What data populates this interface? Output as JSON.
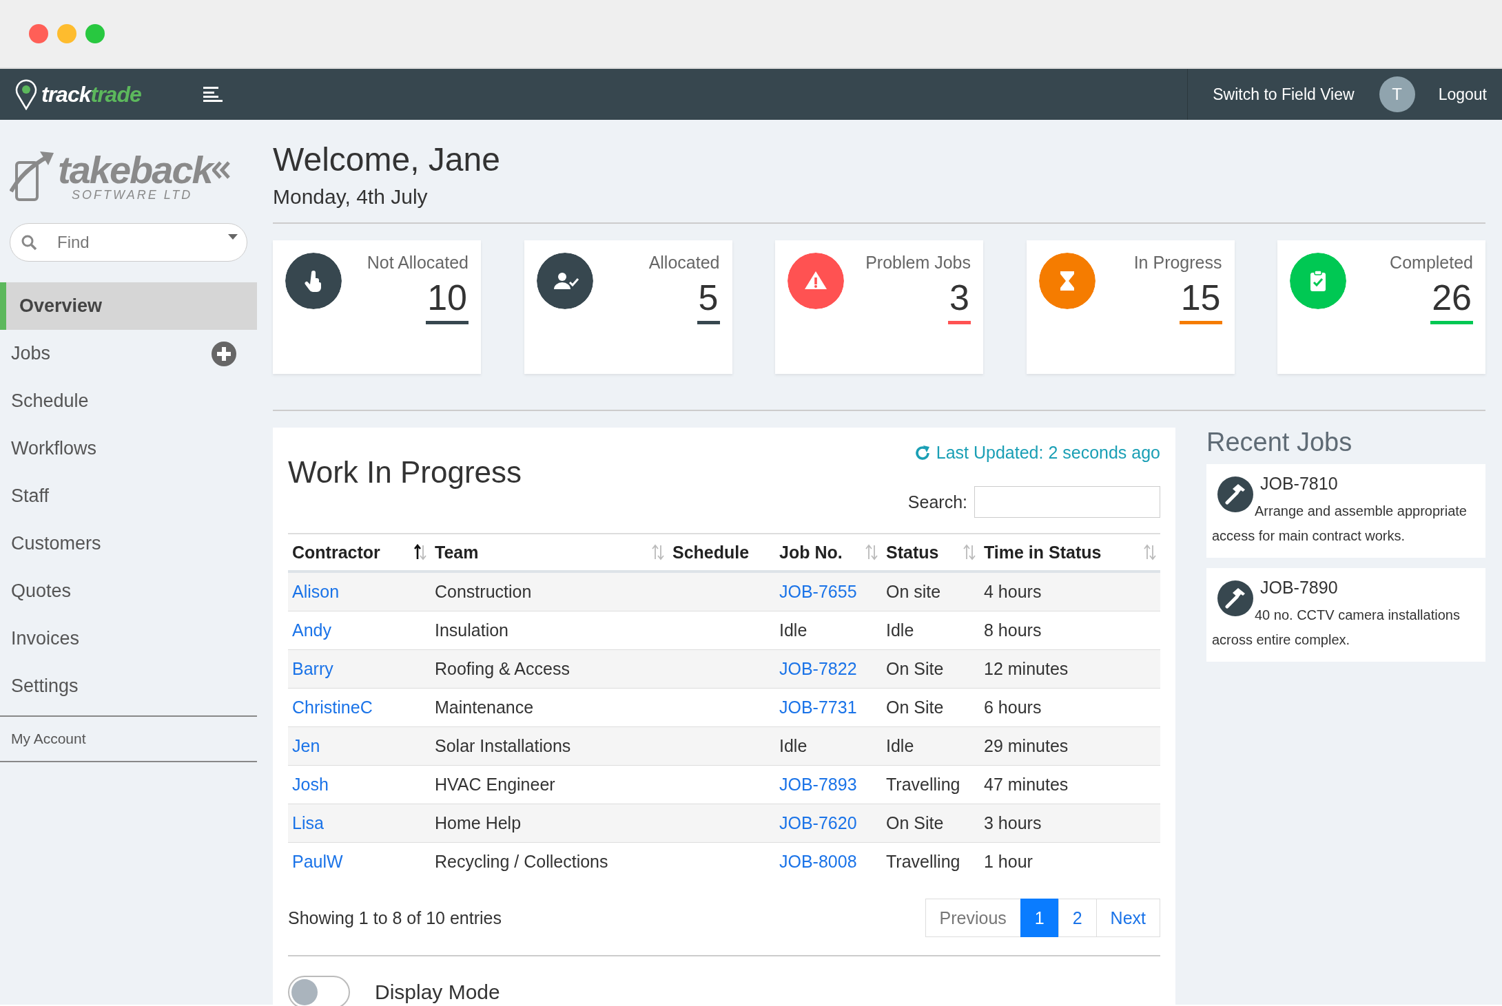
{
  "nav_bar": {
    "brand_part_1": "track",
    "brand_part_2": "trade",
    "switch_link": "Switch to Field View",
    "avatar_initial": "T",
    "logout": "Logout"
  },
  "sidebar": {
    "logo_name": "takeback",
    "logo_sub": "SOFTWARE LTD",
    "find": {
      "placeholder": "Find"
    },
    "items": [
      {
        "label": "Overview",
        "selected": true,
        "add_button": false
      },
      {
        "label": "Jobs",
        "selected": false,
        "add_button": true
      },
      {
        "label": "Schedule",
        "selected": false,
        "add_button": false
      },
      {
        "label": "Workflows",
        "selected": false,
        "add_button": false
      },
      {
        "label": "Staff",
        "selected": false,
        "add_button": false
      },
      {
        "label": "Customers",
        "selected": false,
        "add_button": false
      },
      {
        "label": "Quotes",
        "selected": false,
        "add_button": false
      },
      {
        "label": "Invoices",
        "selected": false,
        "add_button": false
      },
      {
        "label": "Settings",
        "selected": false,
        "add_button": false
      }
    ],
    "account": "My Account"
  },
  "header": {
    "welcome": "Welcome, Jane",
    "date": "Monday, 4th July"
  },
  "stat_cards": [
    {
      "label": "Not Allocated",
      "value": "10",
      "color": "#37474f"
    },
    {
      "label": "Allocated",
      "value": "5",
      "color": "#37474f"
    },
    {
      "label": "Problem Jobs",
      "value": "3",
      "color": "#ff5252"
    },
    {
      "label": "In Progress",
      "value": "15",
      "color": "#f57c00"
    },
    {
      "label": "Completed",
      "value": "26",
      "color": "#00c853"
    }
  ],
  "work_in_progress": {
    "title": "Work In Progress",
    "last_updated": "Last Updated: 2 seconds ago",
    "search_label": "Search:",
    "columns": [
      {
        "label": "Contractor",
        "sortable": true,
        "sorted": true
      },
      {
        "label": "Team",
        "sortable": true,
        "sorted": false
      },
      {
        "label": "Schedule",
        "sortable": false
      },
      {
        "label": "Job No.",
        "sortable": true,
        "sorted": false
      },
      {
        "label": "Status",
        "sortable": true,
        "sorted": false
      },
      {
        "label": "Time in Status",
        "sortable": true,
        "sorted": false
      }
    ],
    "rows": [
      {
        "contractor": "Alison",
        "team": "Construction",
        "job": "JOB-7655",
        "job_link": true,
        "status": "On site",
        "time": "4 hours"
      },
      {
        "contractor": "Andy",
        "team": "Insulation",
        "job": "Idle",
        "job_link": false,
        "status": "Idle",
        "time": "8 hours"
      },
      {
        "contractor": "Barry",
        "team": "Roofing & Access",
        "job": "JOB-7822",
        "job_link": true,
        "status": "On Site",
        "time": "12 minutes"
      },
      {
        "contractor": "ChristineC",
        "team": "Maintenance",
        "job": "JOB-7731",
        "job_link": true,
        "status": "On Site",
        "time": "6 hours"
      },
      {
        "contractor": "Jen",
        "team": "Solar Installations",
        "job": "Idle",
        "job_link": false,
        "status": "Idle",
        "time": "29 minutes"
      },
      {
        "contractor": "Josh",
        "team": "HVAC Engineer",
        "job": "JOB-7893",
        "job_link": true,
        "status": "Travelling",
        "time": "47 minutes"
      },
      {
        "contractor": "Lisa",
        "team": "Home Help",
        "job": "JOB-7620",
        "job_link": true,
        "status": "On Site",
        "time": "3 hours"
      },
      {
        "contractor": "PaulW",
        "team": "Recycling / Collections",
        "job": "JOB-8008",
        "job_link": true,
        "status": "Travelling",
        "time": "1 hour"
      }
    ],
    "info": "Showing 1 to 8 of 10 entries",
    "pagination": [
      {
        "label": "Previous",
        "selected": false,
        "disabled": true
      },
      {
        "label": "1",
        "selected": true,
        "disabled": false
      },
      {
        "label": "2",
        "selected": false,
        "disabled": false
      },
      {
        "label": "Next",
        "selected": false,
        "disabled": false
      }
    ],
    "display_mode": {
      "label": "Display Mode",
      "on": false
    }
  },
  "recent_jobs": {
    "title": "Recent Jobs",
    "items": [
      {
        "job": "JOB-7810",
        "description": "Arrange and assemble appropriate access for main contract works."
      },
      {
        "job": "JOB-7890",
        "description": "40 no. CCTV camera installations across entire complex."
      }
    ]
  }
}
